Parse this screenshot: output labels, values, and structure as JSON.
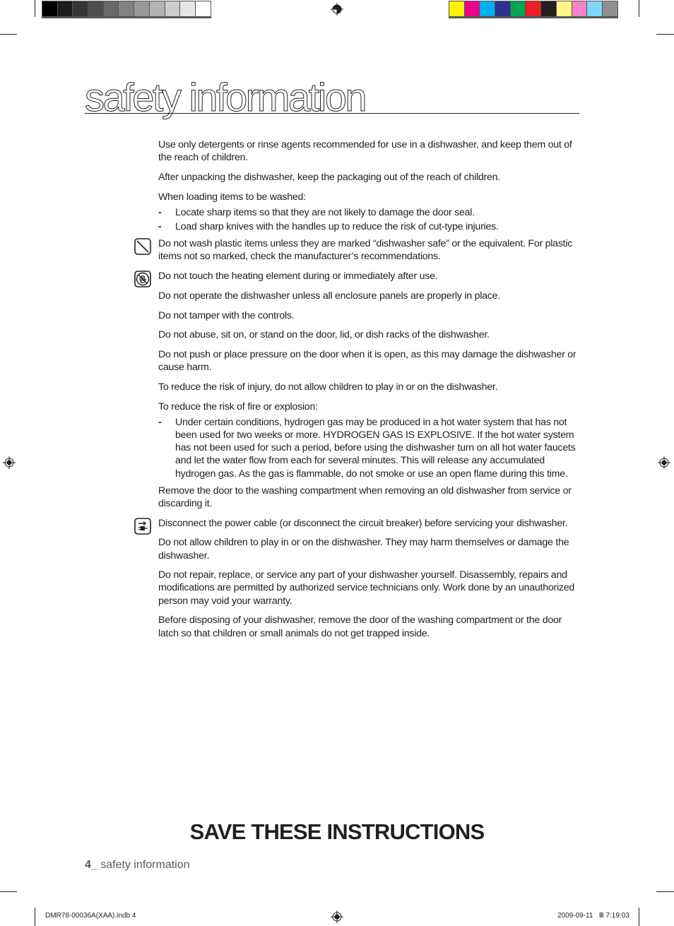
{
  "print_marks": {
    "grayscale_swatches": [
      "#000000",
      "#1c1c1c",
      "#353535",
      "#4f4f4f",
      "#686868",
      "#818181",
      "#9a9a9a",
      "#b3b3b3",
      "#cdcdcd",
      "#e6e6e6",
      "#ffffff"
    ],
    "color_swatches": [
      "#fff200",
      "#ec008c",
      "#00aeef",
      "#2e3192",
      "#00a651",
      "#ed1c24",
      "#231f20",
      "#fff685",
      "#f683c6",
      "#7fd7f8",
      "#8f8f8f"
    ],
    "slug_file": "DMR78-00036A(XAA).indb   4",
    "slug_date": "2009-09-11",
    "slug_glyph": "Ⅲ",
    "slug_time": "7:19:03"
  },
  "page": {
    "title": "safety information",
    "items": [
      {
        "type": "p",
        "text": "Use only detergents or rinse agents recommended for use in a dishwasher, and keep them out of the reach of children."
      },
      {
        "type": "p",
        "text": "After unpacking the dishwasher, keep the packaging out of the reach of children."
      },
      {
        "type": "p",
        "text": "When loading items to be washed:"
      },
      {
        "type": "bullet",
        "text": "Locate sharp items so that they are not likely to damage the door seal."
      },
      {
        "type": "bullet",
        "text": "Load sharp knives with the handles up to reduce the risk of cut-type injuries."
      },
      {
        "type": "p",
        "icon": "prohibited-icon",
        "text": "Do not wash plastic items unless they are marked “dishwasher safe” or the equivalent. For plastic items not so marked, check the manufacturer’s recommendations."
      },
      {
        "type": "p",
        "icon": "do-not-touch-icon",
        "text": "Do not touch the heating element during or immediately after use."
      },
      {
        "type": "p",
        "text": "Do not operate the dishwasher unless all enclosure panels are properly in place."
      },
      {
        "type": "p",
        "text": "Do not tamper with the controls."
      },
      {
        "type": "p",
        "text": "Do not abuse, sit on, or stand on the door, lid, or dish racks of the dishwasher."
      },
      {
        "type": "p",
        "text": "Do not push or place pressure on the door when it is open, as this may damage the dishwasher or cause harm."
      },
      {
        "type": "p",
        "text": "To reduce the risk of injury, do not allow children to play in or on the dishwasher."
      },
      {
        "type": "p",
        "text": "To reduce the risk of fire or explosion:"
      },
      {
        "type": "bullet",
        "text": "Under certain conditions, hydrogen gas may be produced in a hot water system that has not been used for two weeks or more. HYDROGEN GAS IS EXPLOSIVE. If the hot water system has not been used for such a period, before using the dishwasher turn on all hot water faucets and let the water flow from each for several minutes. This will release any accumulated hydrogen gas. As the gas is flammable, do not smoke or use an open flame during this time."
      },
      {
        "type": "p",
        "text": "Remove the door to the washing compartment when removing an old dishwasher from service or discarding it."
      },
      {
        "type": "p",
        "icon": "unplug-icon",
        "text": "Disconnect the power cable (or disconnect the circuit breaker) before servicing your dishwasher."
      },
      {
        "type": "p",
        "text": "Do not allow children to play in or on the dishwasher. They may harm themselves or damage the dishwasher."
      },
      {
        "type": "p",
        "text": "Do not repair, replace, or service any part of your dishwasher yourself. Disassembly, repairs and modifications are permitted by authorized service technicians only. Work done by an unauthorized person may void your warranty."
      },
      {
        "type": "p",
        "text": "Before disposing of your dishwasher, remove the door of the washing compartment or the door latch so that children or small animals do not get trapped inside."
      }
    ],
    "bullet_dash": "-",
    "save_banner": "SAVE THESE INSTRUCTIONS",
    "footer_page_number": "4_",
    "footer_section": " safety information"
  }
}
